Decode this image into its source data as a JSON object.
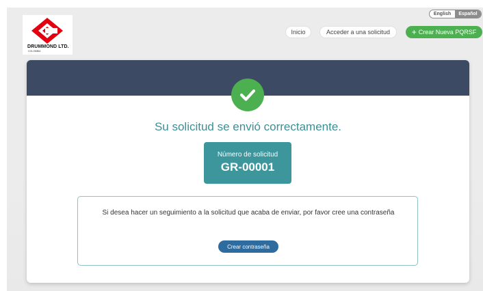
{
  "header": {
    "logo": {
      "name": "DRUMMOND LTD.",
      "subtitle": "COLOMBIA"
    },
    "language": {
      "english_label": "English",
      "spanish_label": "Español",
      "selected": "Español"
    },
    "nav": {
      "home_label": "Inicio",
      "access_label": "Acceder a una solicitud",
      "create_label": "Crear Nueva PQRSF"
    }
  },
  "main": {
    "success_title": "Su solicitud se envió correctamente.",
    "request_number_label": "Número de solicitud",
    "request_number": "GR-00001",
    "info_text": "Si desea hacer un seguimiento a la solicitud que acaba de enviar, por favor cree una contraseña",
    "create_password_label": "Crear contraseña"
  },
  "colors": {
    "header_bar": "#3d4a63",
    "success_green": "#4caf50",
    "accent_teal": "#3d969c",
    "button_blue": "#2e6b9e",
    "logo_red": "#e3000f"
  },
  "icons": [
    "drummond-logo-icon",
    "check-circle-icon",
    "plus-icon"
  ]
}
